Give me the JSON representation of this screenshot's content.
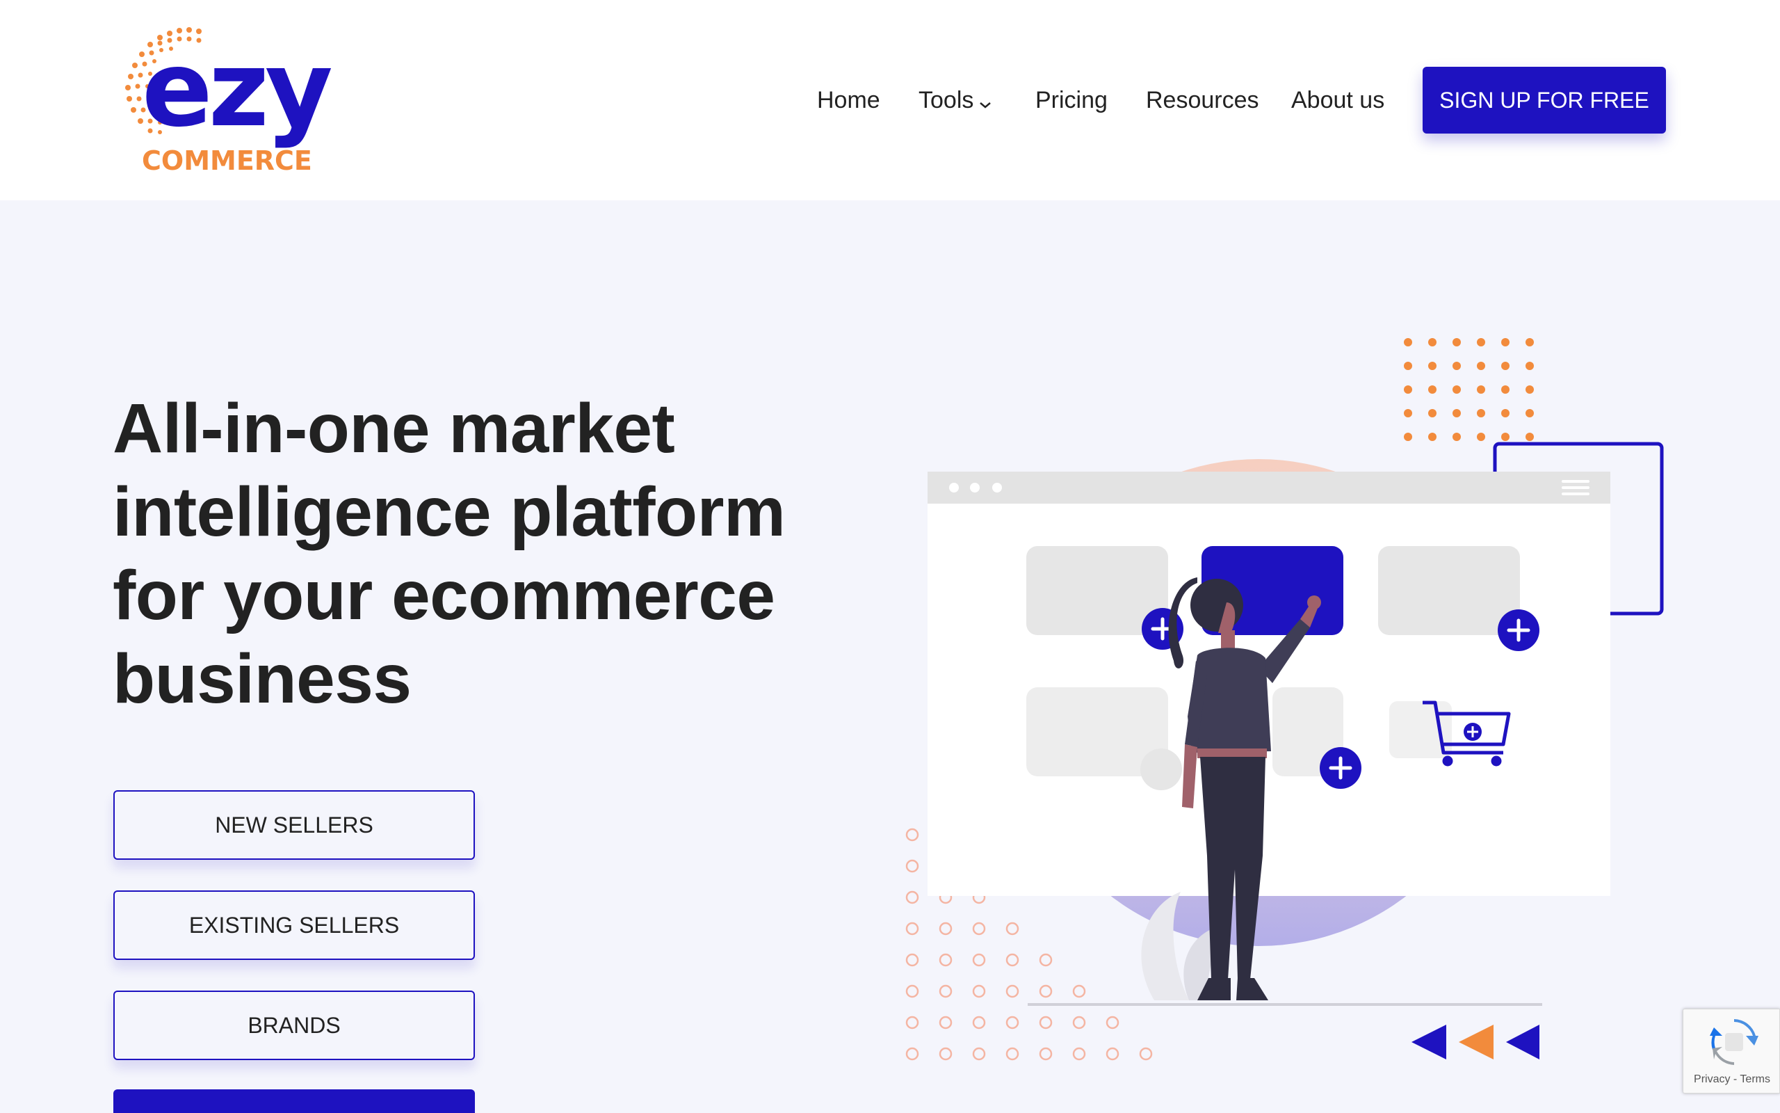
{
  "brand": {
    "logo_main": "ezy",
    "logo_sub": "COMMERCE",
    "colors": {
      "primary": "#1e12c0",
      "accent": "#f28b3c",
      "dark_text": "#222222",
      "background": "#f4f5fc"
    }
  },
  "nav": {
    "items": [
      {
        "label": "Home"
      },
      {
        "label": "Tools",
        "has_dropdown": true
      },
      {
        "label": "Pricing"
      },
      {
        "label": "Resources"
      },
      {
        "label": "About us"
      }
    ],
    "cta_label": "SIGN UP FOR FREE"
  },
  "hero": {
    "title_lines": [
      "All-in-one market",
      "intelligence platform",
      "for your ecommerce",
      "business"
    ],
    "segment_buttons": [
      {
        "label": "NEW SELLERS"
      },
      {
        "label": "EXISTING SELLERS"
      },
      {
        "label": "BRANDS"
      }
    ]
  },
  "recaptcha": {
    "links": "Privacy - Terms"
  },
  "icons": [
    "chevron-down-icon",
    "plus-icon",
    "shopping-cart-icon",
    "hamburger-menu-icon",
    "recaptcha-icon",
    "arrow-left-icon"
  ]
}
